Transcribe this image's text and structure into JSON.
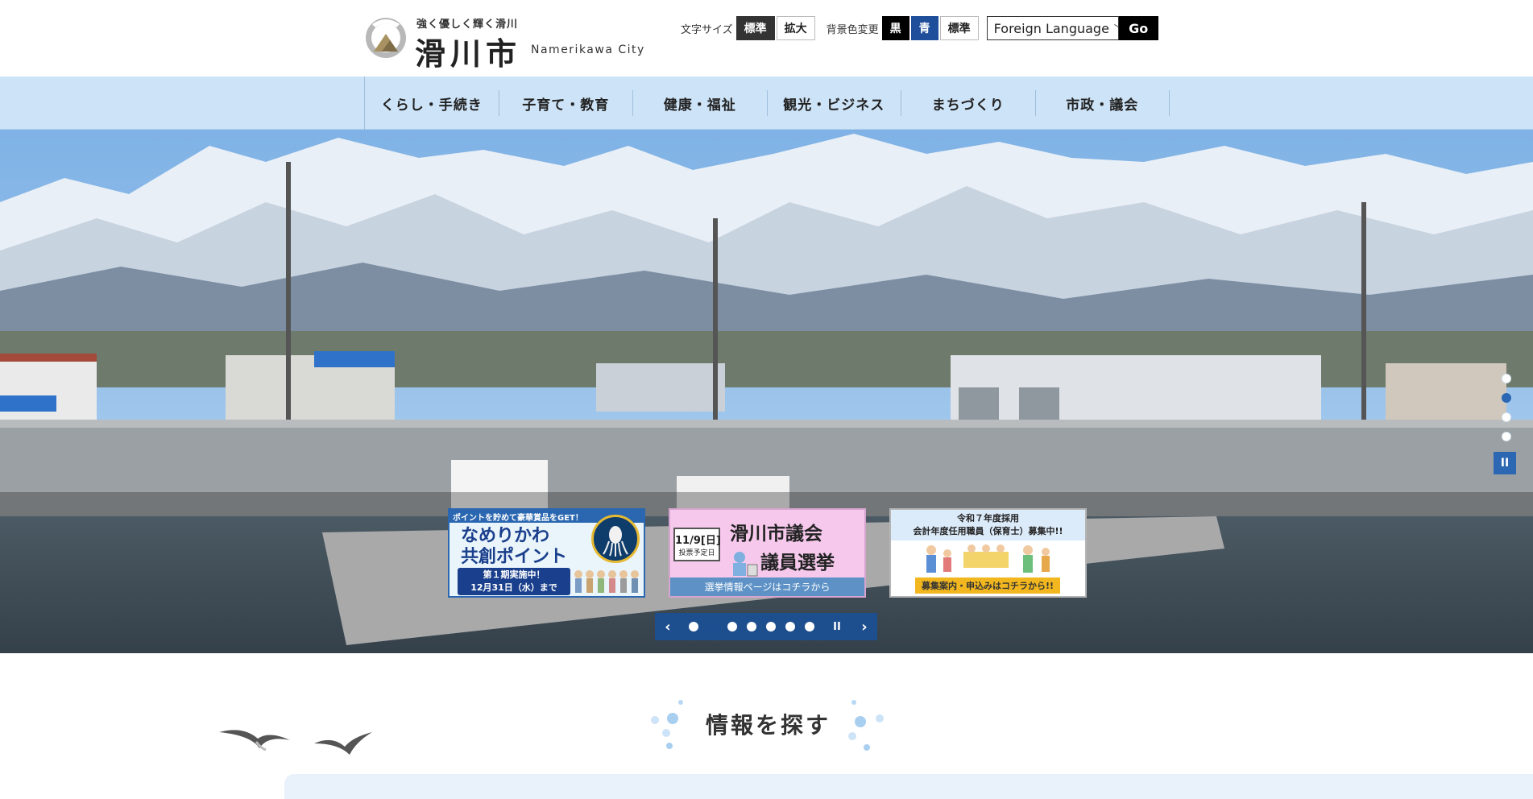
{
  "header": {
    "tagline": "強く優しく輝く滑川",
    "city_name": "滑川市",
    "city_name_en": "Namerikawa City",
    "font_size_label": "文字サイズ",
    "font_size_standard": "標準",
    "font_size_large": "拡大",
    "bg_color_label": "背景色変更",
    "bg_black": "黒",
    "bg_blue": "青",
    "bg_standard": "標準",
    "language_select": "Foreign Language",
    "go_label": "Go"
  },
  "nav": {
    "items": [
      {
        "label": "くらし・手続き"
      },
      {
        "label": "子育て・教育"
      },
      {
        "label": "健康・福祉"
      },
      {
        "label": "観光・ビジネス"
      },
      {
        "label": "まちづくり"
      },
      {
        "label": "市政・議会"
      }
    ]
  },
  "hero": {
    "slide_count": 4,
    "active_slide": 2,
    "pause_label": "II"
  },
  "banners": [
    {
      "top": "ポイントを貯めて豪華賞品をGET！",
      "line1": "なめりかわ",
      "line2": "共創ポイント",
      "period1": "第１期実施中！",
      "period2": "12月31日（水）まで"
    },
    {
      "date": "11/9[日]",
      "date_sub": "投票予定日",
      "line1": "滑川市議会",
      "line2": "議員選挙",
      "foot": "選挙情報ページはコチラから"
    },
    {
      "hdr1": "令和７年度採用",
      "hdr2": "会計年度任用職員（保育士）募集中!!",
      "foot": "募集案内・申込みはコチラから!!"
    }
  ],
  "banner_controls": {
    "prev": "‹",
    "next": "›",
    "pause": "II",
    "dot_count": 7,
    "active_dot": 2
  },
  "search_section": {
    "title": "情報を探す"
  },
  "colors": {
    "nav_bg": "#cde3f7",
    "accent_blue": "#2b67b3",
    "control_blue": "#1d4f8f"
  }
}
